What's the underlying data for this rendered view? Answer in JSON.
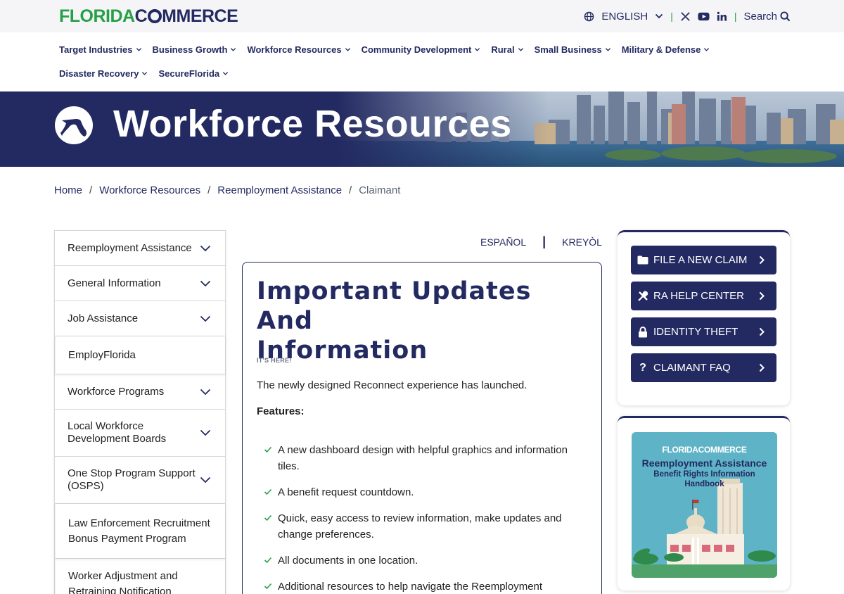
{
  "header": {
    "logo_part1": "FLORIDA",
    "logo_part2": "C",
    "logo_part3": "MMERCE",
    "language": "ENGLISH",
    "search_label": "Search",
    "social": [
      "x-icon",
      "youtube-icon",
      "linkedin-icon"
    ]
  },
  "nav": {
    "items": [
      {
        "label": "Target Industries"
      },
      {
        "label": "Business Growth"
      },
      {
        "label": "Workforce Resources"
      },
      {
        "label": "Community Development"
      },
      {
        "label": "Rural"
      },
      {
        "label": "Small Business"
      },
      {
        "label": "Military & Defense"
      },
      {
        "label": "Disaster Recovery"
      },
      {
        "label": "SecureFlorida"
      }
    ]
  },
  "banner": {
    "title": "Workforce Resources"
  },
  "breadcrumb": {
    "items": [
      "Home",
      "Workforce Resources",
      "Reemployment Assistance"
    ],
    "current": "Claimant"
  },
  "sidebar": {
    "items": [
      {
        "label": "Reemployment Assistance"
      },
      {
        "label": "General Information"
      },
      {
        "label": "Job Assistance"
      },
      {
        "label": "EmployFlorida"
      },
      {
        "label": "Workforce Programs"
      },
      {
        "label_line1": "Local Workforce",
        "label_line2": "Development Boards"
      },
      {
        "label_line1": "One Stop Program Support",
        "label_line2": "(OSPS)"
      },
      {
        "label_line1": "Law Enforcement Recruitment",
        "label_line2": "Bonus Payment Program"
      },
      {
        "label_line1": "Worker Adjustment and",
        "label_line2": "Retraining Notification"
      }
    ]
  },
  "language_links": {
    "spanish": "ESPAÑOL",
    "separator": "|",
    "creole": "KREYÒL"
  },
  "main": {
    "title_line1": "Important Updates And",
    "title_line2": "Information",
    "eyebrow": "IT'S HERE!",
    "lead": "The newly designed Reconnect experience has launched.",
    "features_label": "Features:",
    "features": [
      {
        "line1": "A new dashboard design with helpful graphics and information",
        "line2": "tiles."
      },
      {
        "line1": "A benefit request countdown.",
        "line2": ""
      },
      {
        "line1": "Quick, easy access to review information, make updates and",
        "line2": "change preferences."
      },
      {
        "line1": "All documents in one location.",
        "line2": ""
      },
      {
        "line1": "Additional resources to help navigate the Reemployment",
        "line2": ""
      }
    ]
  },
  "cta": {
    "buttons": [
      {
        "label": "FILE A NEW CLAIM",
        "icon": "folder-icon"
      },
      {
        "label": "RA HELP CENTER",
        "icon": "tools-icon"
      },
      {
        "label": "IDENTITY THEFT",
        "icon": "lock-icon"
      },
      {
        "label": "CLAIMANT FAQ",
        "icon": "question-icon"
      }
    ]
  },
  "handbook": {
    "logo": "FLORIDACOMMERCE",
    "title": "Reemployment Assistance",
    "subtitle_line1": "Benefit Rights Information",
    "subtitle_line2": "Handbook"
  },
  "colors": {
    "brand_navy": "#232a61",
    "brand_green": "#26a046"
  }
}
